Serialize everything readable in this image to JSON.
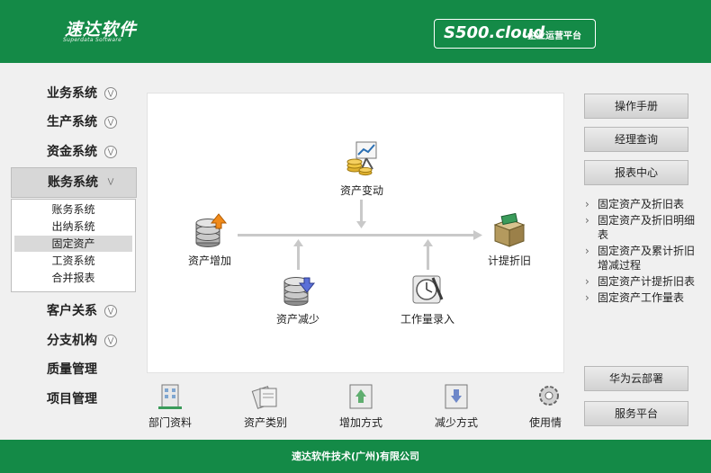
{
  "header": {
    "logo_cn": "速达软件",
    "logo_en": "Superdata Software",
    "brand_main": "S500.cloud",
    "brand_sub": "企业运营平台"
  },
  "nav": {
    "items": [
      {
        "label": "业务系统"
      },
      {
        "label": "生产系统"
      },
      {
        "label": "资金系统"
      },
      {
        "label": "账务系统"
      },
      {
        "label": "客户关系"
      },
      {
        "label": "分支机构"
      },
      {
        "label": "质量管理"
      },
      {
        "label": "项目管理"
      }
    ],
    "submenu": [
      "账务系统",
      "出纳系统",
      "固定资产",
      "工资系统",
      "合并报表"
    ],
    "submenu_selected": "固定资产"
  },
  "flow": {
    "asset_change": "资产变动",
    "asset_add": "资产增加",
    "depreciation": "计提折旧",
    "asset_reduce": "资产减少",
    "workload": "工作量录入"
  },
  "dock": [
    "部门资料",
    "资产类别",
    "增加方式",
    "减少方式",
    "使用情"
  ],
  "right": {
    "buttons": [
      "操作手册",
      "经理查询",
      "报表中心"
    ],
    "reports": [
      "固定资产及折旧表",
      "固定资产及折旧明细表",
      "固定资产及累计折旧增减过程",
      "固定资产计提折旧表",
      "固定资产工作量表"
    ],
    "bottom_buttons": [
      "华为云部署",
      "服务平台"
    ]
  },
  "footer": "速达软件技术(广州)有限公司",
  "colors": {
    "header_green": "#148a47",
    "panel_bg": "#ffffff",
    "page_bg": "#f0f0f0"
  }
}
